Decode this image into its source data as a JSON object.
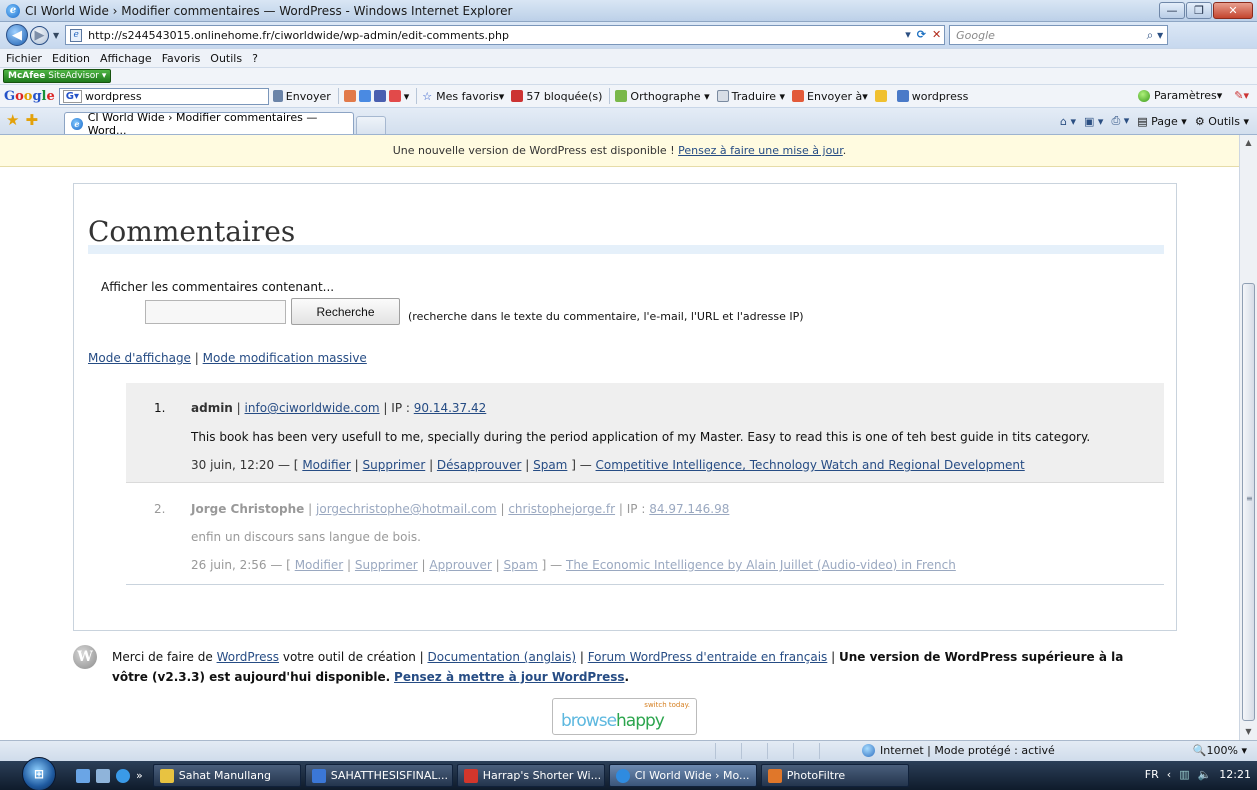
{
  "window": {
    "title": "CI World Wide › Modifier commentaires — WordPress - Windows Internet Explorer",
    "buttons": {
      "minimize": "—",
      "maximize": "❐",
      "close": "✕"
    }
  },
  "address": {
    "url": "http://s244543015.onlinehome.fr/ciworldwide/wp-admin/edit-comments.php",
    "search_placeholder": "Google"
  },
  "menu": [
    "Fichier",
    "Edition",
    "Affichage",
    "Favoris",
    "Outils",
    "?"
  ],
  "mcafee": {
    "brand": "McAfee",
    "product": "SiteAdvisor ▾"
  },
  "google_toolbar": {
    "search_value": "wordpress",
    "envoyer": "Envoyer",
    "favoris": "Mes favoris▾",
    "bloquees": "57 bloquée(s)",
    "orthographe": "Orthographe ▾",
    "traduire": "Traduire ▾",
    "envoyer_a": "Envoyer à▾",
    "wordpress": "wordpress",
    "parametres": "Paramètres▾"
  },
  "tab": {
    "label": "CI World Wide › Modifier commentaires — Word..."
  },
  "command_bar": {
    "page": "Page ▾",
    "outils": "Outils ▾"
  },
  "notice": {
    "text": "Une nouvelle version de WordPress est disponible !",
    "link": "Pensez à faire une mise à jour",
    "end": "."
  },
  "page": {
    "heading": "Commentaires",
    "search_label": "Afficher les commentaires contenant...",
    "search_button": "Recherche",
    "search_hint": "(recherche dans le texte du commentaire, l'e-mail, l'URL et l'adresse IP)",
    "mode_view": "Mode d'affichage",
    "mode_mass": "Mode modification massive",
    "sep": "|"
  },
  "comments": [
    {
      "num": "1.",
      "author": "admin",
      "email": "info@ciworldwide.com",
      "ip_label": "IP :",
      "ip": "90.14.37.42",
      "text": "This book has been very usefull to me, specially during the period application of my Master. Easy to read this is one of teh best guide in tits category.",
      "date": "30 juin, 12:20 — [",
      "modifier": "Modifier",
      "supprimer": "Supprimer",
      "action": "Désapprouver",
      "spam": "Spam",
      "close": "] —",
      "post": "Competitive Intelligence, Technology Watch and Regional Development"
    },
    {
      "num": "2.",
      "author": "Jorge Christophe",
      "email": "jorgechristophe@hotmail.com",
      "url": "christophejorge.fr",
      "ip_label": "IP :",
      "ip": "84.97.146.98",
      "text": "enfin un discours sans langue de bois.",
      "date": "26 juin, 2:56 — [",
      "modifier": "Modifier",
      "supprimer": "Supprimer",
      "action": "Approuver",
      "spam": "Spam",
      "close": "] —",
      "post": "The Economic Intelligence by Alain Juillet (Audio-video) in French"
    }
  ],
  "footer": {
    "merci": "Merci de faire de",
    "wordpress": "WordPress",
    "outil": "votre outil de création |",
    "documentation": "Documentation (anglais)",
    "forum": "Forum WordPress d'entraide en français",
    "upgrade_text": "Une version de WordPress supérieure à la vôtre (v2.3.3) est aujourd'hui disponible.",
    "upgrade_link": "Pensez à mettre à jour WordPress",
    "period": "."
  },
  "browsehappy": {
    "switch": "switch today.",
    "browse": "browse",
    "happy": "happy"
  },
  "status": {
    "zone": "Internet | Mode protégé : activé",
    "zoom": "🔍100% ▾"
  },
  "taskbar": {
    "tasks": [
      {
        "label": "Sahat Manullang",
        "color": "#e8c341"
      },
      {
        "label": "SAHATTHESISFINAL...",
        "color": "#3b77d6"
      },
      {
        "label": "Harrap's Shorter Wi...",
        "color": "#d3362b"
      },
      {
        "label": "CI World Wide › Mo...",
        "color": "#2f8be0"
      },
      {
        "label": "PhotoFiltre",
        "color": "#e0772a"
      }
    ],
    "lang": "FR",
    "time": "12:21",
    "chevron": "»"
  }
}
